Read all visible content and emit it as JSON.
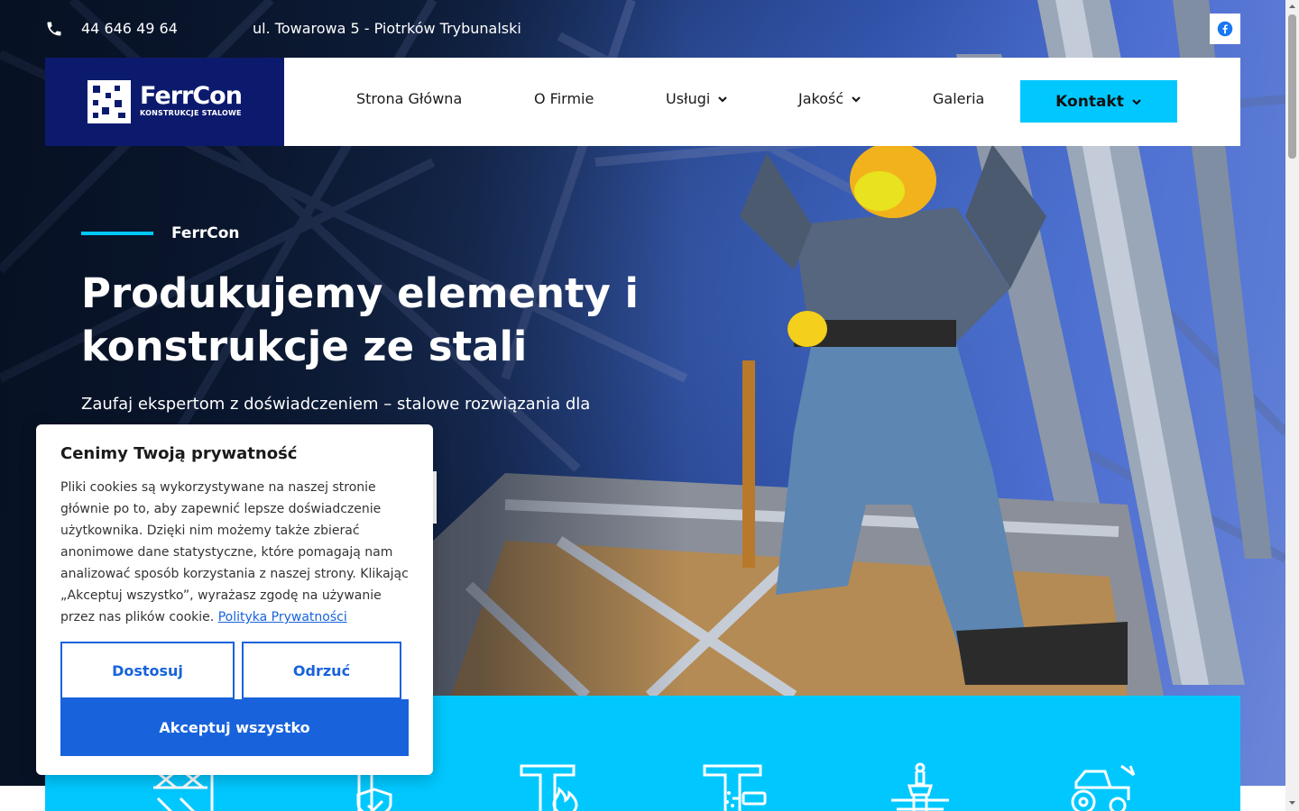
{
  "topbar": {
    "phone": "44 646 49 64",
    "address": "ul. Towarowa 5 - Piotrków Trybunalski",
    "social": "facebook-icon"
  },
  "logo": {
    "title": "FerrCon",
    "subtitle": "KONSTRUKCJE STALOWE"
  },
  "nav": {
    "items": [
      {
        "label": "Strona Główna"
      },
      {
        "label": "O Firmie"
      },
      {
        "label": "Usługi"
      },
      {
        "label": "Jakość"
      },
      {
        "label": "Galeria"
      }
    ],
    "contact": "Kontakt"
  },
  "hero": {
    "eyebrow": "FerrCon",
    "headline": "Produkujemy elementy i konstrukcje ze stali",
    "lead": "Zaufaj ekspertom z doświadczeniem – stalowe rozwiązania dla"
  },
  "cookie": {
    "title": "Cenimy Twoją prywatność",
    "text": "Pliki cookies są wykorzystywane na naszej stronie głównie po to, aby zapewnić lepsze doświadczenie użytkownika. Dzięki nim możemy także zbierać anonimowe dane statystyczne, które pomagają nam analizować sposób korzystania z naszej strony. Klikając „Akceptuj wszystko”, wyrażasz zgodę na używanie przez nas plików cookie.",
    "link": "Polityka Prywatności",
    "customize": "Dostosuj",
    "reject": "Odrzuć",
    "accept": "Akceptuj wszystko"
  },
  "colors": {
    "accent": "#00c8ff",
    "brand": "#0c1a6e",
    "cookie_button": "#1863dc"
  },
  "services": {
    "icons": [
      "scaffold-icon",
      "steel-beam-shield-icon",
      "steel-beam-fire-icon",
      "steel-beam-spray-icon",
      "paint-brush-icon",
      "tractor-icon"
    ]
  }
}
